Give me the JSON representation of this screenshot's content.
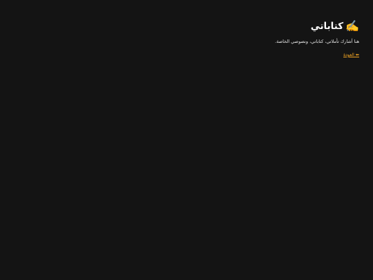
{
  "header": {
    "icon": "writing-hand-icon",
    "icon_glyph": "✍️",
    "title": "كتاباتي"
  },
  "intro": {
    "description": "هنا أشارك تأملاتي، كتاباتي، ونصوصي الخاصة."
  },
  "nav": {
    "back_label": "⬅ العودة"
  },
  "colors": {
    "background": "#141414",
    "text": "#ffffff",
    "link": "#f5a623"
  }
}
